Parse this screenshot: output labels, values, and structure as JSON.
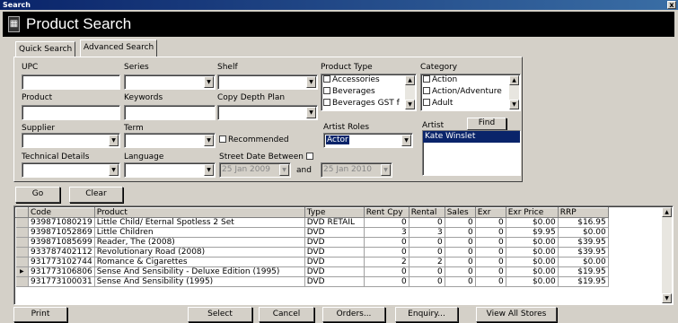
{
  "window": {
    "title": "Search",
    "close": "x"
  },
  "header": {
    "title": "Product Search"
  },
  "tabs": [
    {
      "label": "Quick Search"
    },
    {
      "label": "Advanced Search"
    }
  ],
  "form": {
    "upc_label": "UPC",
    "series_label": "Series",
    "shelf_label": "Shelf",
    "product_type_label": "Product Type",
    "category_label": "Category",
    "product_label": "Product",
    "keywords_label": "Keywords",
    "copy_depth_label": "Copy Depth Plan",
    "supplier_label": "Supplier",
    "term_label": "Term",
    "recommended_label": "Recommended",
    "artist_roles_label": "Artist Roles",
    "artist_roles_value": "Actor",
    "artist_label": "Artist",
    "find_label": "Find",
    "technical_label": "Technical Details",
    "language_label": "Language",
    "street_date_label": "Street Date Between",
    "date_from": "25 Jan 2009",
    "and_label": "and",
    "date_to": "25 Jan 2010",
    "product_types": [
      "Accessories",
      "Beverages",
      "Beverages GST f"
    ],
    "categories": [
      "Action",
      "Action/Adventure",
      "Adult"
    ],
    "artists": [
      "Kate Winslet"
    ]
  },
  "actions": {
    "go": "Go",
    "clear": "Clear"
  },
  "grid": {
    "columns": [
      "Code",
      "Product",
      "Type",
      "Rent Cpy",
      "Rental",
      "Sales",
      "Exr",
      "Exr Price",
      "RRP"
    ],
    "rows": [
      [
        "939871080219",
        "Little Child/ Eternal Spotless 2 Set",
        "DVD RETAIL",
        "0",
        "0",
        "0",
        "0",
        "$0.00",
        "$16.95"
      ],
      [
        "939871052869",
        "Little Children",
        "DVD",
        "3",
        "3",
        "0",
        "0",
        "$9.95",
        "$0.00"
      ],
      [
        "939871085699",
        "Reader, The (2008)",
        "DVD",
        "0",
        "0",
        "0",
        "0",
        "$0.00",
        "$39.95"
      ],
      [
        "933787402112",
        "Revolutionary Road (2008)",
        "DVD",
        "0",
        "0",
        "0",
        "0",
        "$0.00",
        "$39.95"
      ],
      [
        "931773102744",
        "Romance & Cigarettes",
        "DVD",
        "2",
        "2",
        "0",
        "0",
        "$0.00",
        "$0.00"
      ],
      [
        "931773106806",
        "Sense And Sensibility - Deluxe Edition (1995)",
        "DVD",
        "0",
        "0",
        "0",
        "0",
        "$0.00",
        "$19.95"
      ],
      [
        "931773100031",
        "Sense And Sensibility (1995)",
        "DVD",
        "0",
        "0",
        "0",
        "0",
        "$0.00",
        "$19.95"
      ]
    ]
  },
  "footer": {
    "print": "Print",
    "select": "Select",
    "cancel": "Cancel",
    "orders": "Orders...",
    "enquiry": "Enquiry...",
    "view_all": "View All Stores"
  }
}
